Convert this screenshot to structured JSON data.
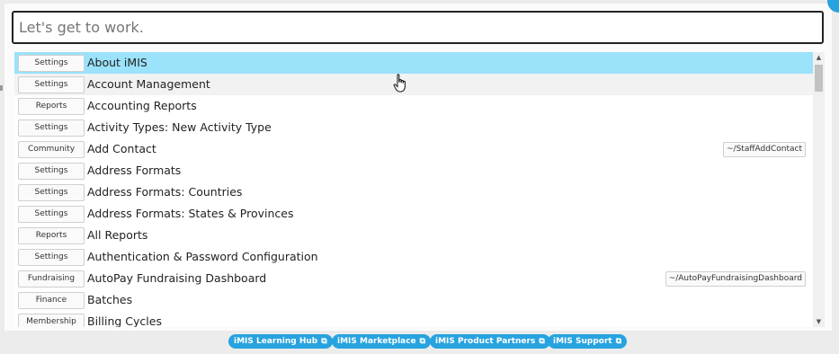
{
  "search": {
    "placeholder": "Let's get to work."
  },
  "results": [
    {
      "category": "Settings",
      "label": "About iMIS",
      "path": ""
    },
    {
      "category": "Settings",
      "label": "Account Management",
      "path": ""
    },
    {
      "category": "Reports",
      "label": "Accounting Reports",
      "path": ""
    },
    {
      "category": "Settings",
      "label": "Activity Types: New Activity Type",
      "path": ""
    },
    {
      "category": "Community",
      "label": "Add Contact",
      "path": "~/StaffAddContact"
    },
    {
      "category": "Settings",
      "label": "Address Formats",
      "path": ""
    },
    {
      "category": "Settings",
      "label": "Address Formats: Countries",
      "path": ""
    },
    {
      "category": "Settings",
      "label": "Address Formats: States & Provinces",
      "path": ""
    },
    {
      "category": "Reports",
      "label": "All Reports",
      "path": ""
    },
    {
      "category": "Settings",
      "label": "Authentication & Password Configuration",
      "path": ""
    },
    {
      "category": "Fundraising",
      "label": "AutoPay Fundraising Dashboard",
      "path": "~/AutoPayFundraisingDashboard"
    },
    {
      "category": "Finance",
      "label": "Batches",
      "path": ""
    },
    {
      "category": "Membership",
      "label": "Billing Cycles",
      "path": ""
    }
  ],
  "footer": {
    "links": [
      {
        "label": "iMIS Learning Hub"
      },
      {
        "label": "iMIS Marketplace"
      },
      {
        "label": "iMIS Product Partners"
      },
      {
        "label": "iMIS Support"
      }
    ]
  },
  "icons": {
    "external_link": "external-link-icon",
    "scroll_up": "chevron-up-icon",
    "scroll_down": "chevron-down-icon",
    "cursor": "hand-pointer-icon"
  },
  "colors": {
    "highlight": "#9be2fb",
    "accent": "#27a3df"
  }
}
